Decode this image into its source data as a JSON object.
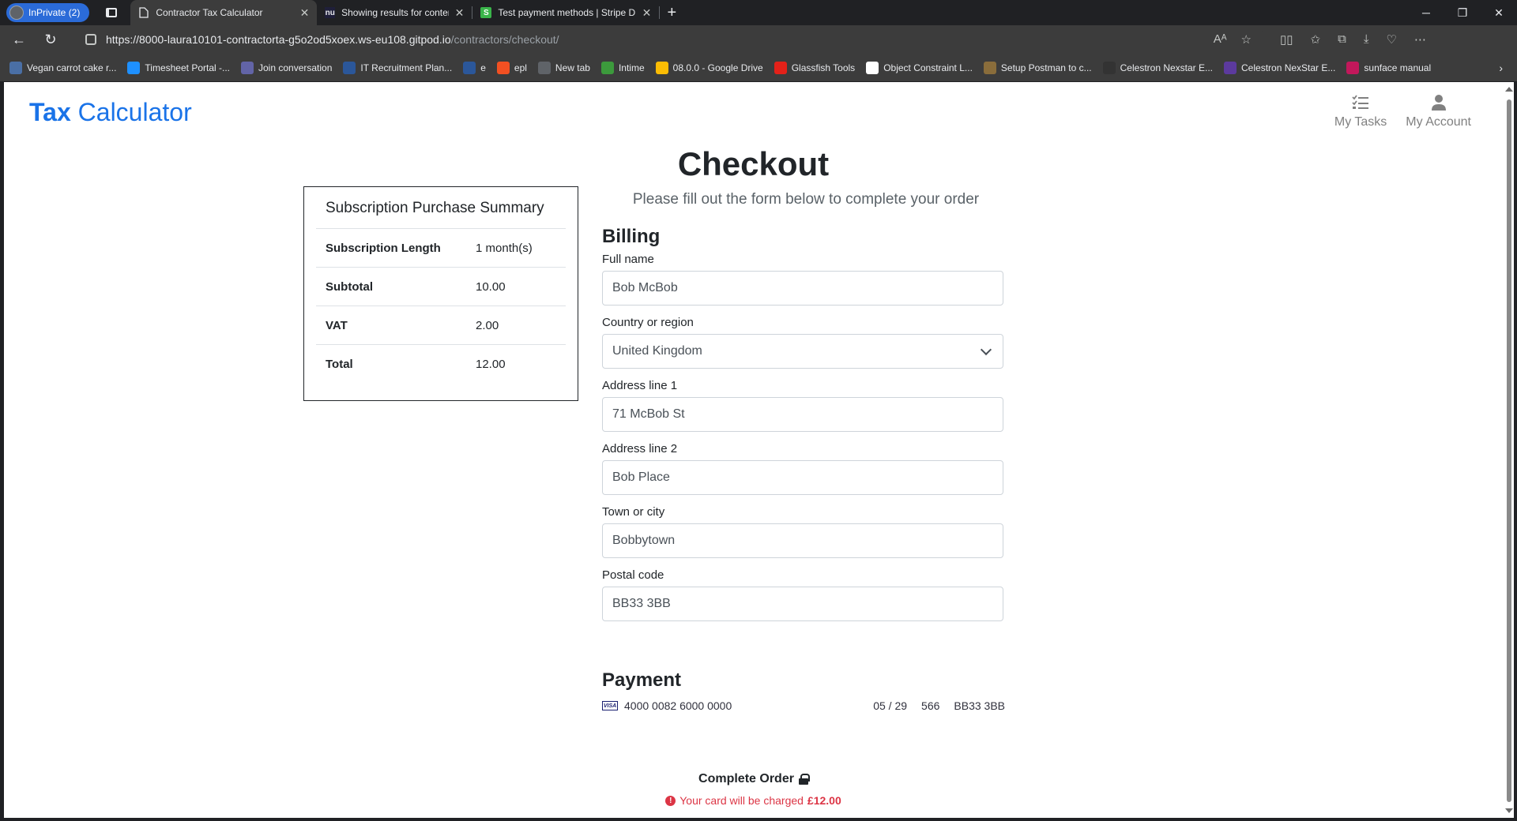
{
  "browser": {
    "profile_label": "InPrivate (2)",
    "tabs": [
      {
        "title": "Contractor Tax Calculator",
        "icon": "page-icon",
        "active": true
      },
      {
        "title": "Showing results for contents of t",
        "icon": "nu",
        "active": false
      },
      {
        "title": "Test payment methods | Stripe D",
        "icon": "S",
        "active": false
      }
    ],
    "url_host": "https://8000-laura10101-contractorta-g5o2od5xoex.ws-eu108.gitpod.io",
    "url_path": "/contractors/checkout/",
    "bookmarks": [
      {
        "label": "Vegan carrot cake r...",
        "color": "#4a6fa5"
      },
      {
        "label": "Timesheet Portal -...",
        "color": "#1e90ff"
      },
      {
        "label": "Join conversation",
        "color": "#6264a7"
      },
      {
        "label": "IT Recruitment Plan...",
        "color": "#2b579a"
      },
      {
        "label": "e",
        "color": "#2b579a"
      },
      {
        "label": "epl",
        "color": "#f25022"
      },
      {
        "label": "New tab",
        "color": "#5f6368"
      },
      {
        "label": "Intime",
        "color": "#3c9a3c"
      },
      {
        "label": "08.0.0 - Google Drive",
        "color": "#fbbc04"
      },
      {
        "label": "Glassfish Tools",
        "color": "#e32119"
      },
      {
        "label": "Object Constraint L...",
        "color": "#ffffff"
      },
      {
        "label": "Setup Postman to c...",
        "color": "#8a6d3b"
      },
      {
        "label": "Celestron Nexstar E...",
        "color": "#333333"
      },
      {
        "label": "Celestron NexStar E...",
        "color": "#5c3a9e"
      },
      {
        "label": "sunface manual",
        "color": "#c2185b"
      }
    ]
  },
  "header": {
    "brand_bold": "Tax",
    "brand_rest": "Calculator",
    "nav": [
      {
        "label": "My Tasks",
        "icon": "tasks-icon"
      },
      {
        "label": "My Account",
        "icon": "user-icon"
      }
    ]
  },
  "checkout": {
    "title": "Checkout",
    "subtitle": "Please fill out the form below to complete your order"
  },
  "summary": {
    "title": "Subscription Purchase Summary",
    "rows": [
      {
        "label": "Subscription Length",
        "value": "1 month(s)"
      },
      {
        "label": "Subtotal",
        "value": "10.00"
      },
      {
        "label": "VAT",
        "value": "2.00"
      },
      {
        "label": "Total",
        "value": "12.00"
      }
    ]
  },
  "billing": {
    "heading": "Billing",
    "full_name": {
      "label": "Full name",
      "value": "Bob McBob"
    },
    "country": {
      "label": "Country or region",
      "value": "United Kingdom"
    },
    "address1": {
      "label": "Address line 1",
      "value": "71 McBob St"
    },
    "address2": {
      "label": "Address line 2",
      "value": "Bob Place"
    },
    "town": {
      "label": "Town or city",
      "value": "Bobbytown"
    },
    "postcode": {
      "label": "Postal code",
      "value": "BB33 3BB"
    }
  },
  "payment": {
    "heading": "Payment",
    "card_brand": "VISA",
    "card_number": "4000 0082 6000 0000",
    "expiry": "05 / 29",
    "cvc": "566",
    "postcode": "BB33 3BB"
  },
  "order": {
    "button_label": "Complete Order",
    "charge_prefix": "Your card will be charged",
    "charge_amount": "£12.00"
  }
}
